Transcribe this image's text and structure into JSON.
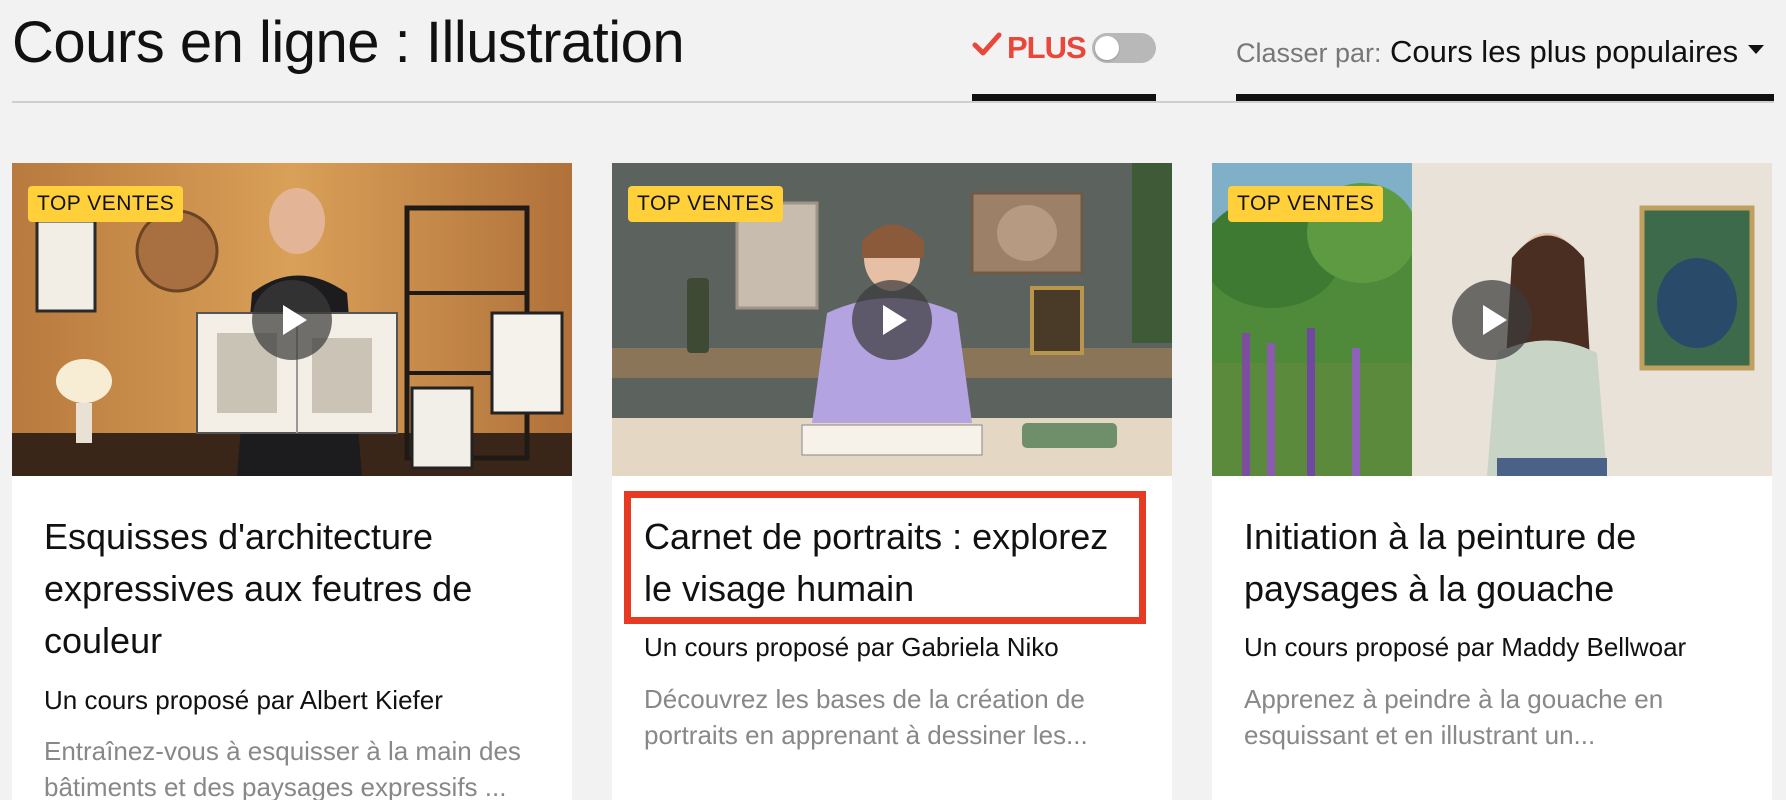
{
  "page": {
    "title": "Cours en ligne : Illustration"
  },
  "filters": {
    "plus_label": "PLUS",
    "plus_toggle_on": false,
    "colors": {
      "plus_red": "#e8473a",
      "plus_pink": "#d93c8c",
      "badge": "#ffd03a",
      "highlight": "#e63a23"
    }
  },
  "sort": {
    "label": "Classer par:",
    "value": "Cours les plus populaires"
  },
  "cards": [
    {
      "badge": "TOP VENTES",
      "title": "Esquisses d'architecture expressives aux feutres de couleur",
      "author": "Un cours proposé par Albert Kiefer",
      "description": "Entraînez-vous à esquisser à la main des bâtiments et des paysages expressifs ..."
    },
    {
      "badge": "TOP VENTES",
      "title": "Carnet de portraits : explorez le visage humain",
      "author": "Un cours proposé par Gabriela Niko",
      "description": "Découvrez les bases de la création de portraits en apprenant à dessiner les...",
      "highlighted": true
    },
    {
      "badge": "TOP VENTES",
      "title": "Initiation à la peinture de paysages à la gouache",
      "author": "Un cours proposé par Maddy Bellwoar",
      "description": "Apprenez à peindre à la gouache en esquissant et en illustrant un..."
    }
  ]
}
